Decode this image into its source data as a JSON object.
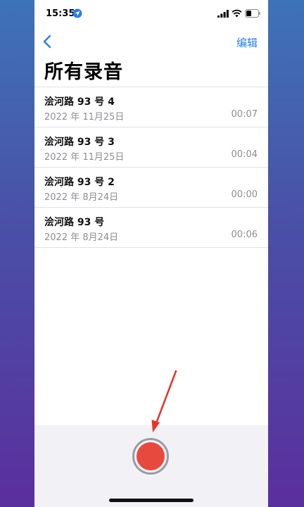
{
  "status_bar": {
    "time": "15:35",
    "icons": [
      "location-icon",
      "signal-icon",
      "wifi-icon",
      "battery-icon"
    ]
  },
  "nav": {
    "back_icon": "chevron-left-icon",
    "edit_label": "编辑"
  },
  "page": {
    "title": "所有录音"
  },
  "recordings": [
    {
      "title": "浍河路 93 号 4",
      "date": "2022 年 11月25日",
      "duration": "00:07"
    },
    {
      "title": "浍河路 93 号 3",
      "date": "2022 年 11月25日",
      "duration": "00:04"
    },
    {
      "title": "浍河路 93 号 2",
      "date": "2022 年 8月24日",
      "duration": "00:00"
    },
    {
      "title": "浍河路 93 号",
      "date": "2022 年 8月24日",
      "duration": "00:06"
    }
  ],
  "colors": {
    "accent": "#2f7de1",
    "record": "#e8493f",
    "annotation": "#e8332a"
  }
}
